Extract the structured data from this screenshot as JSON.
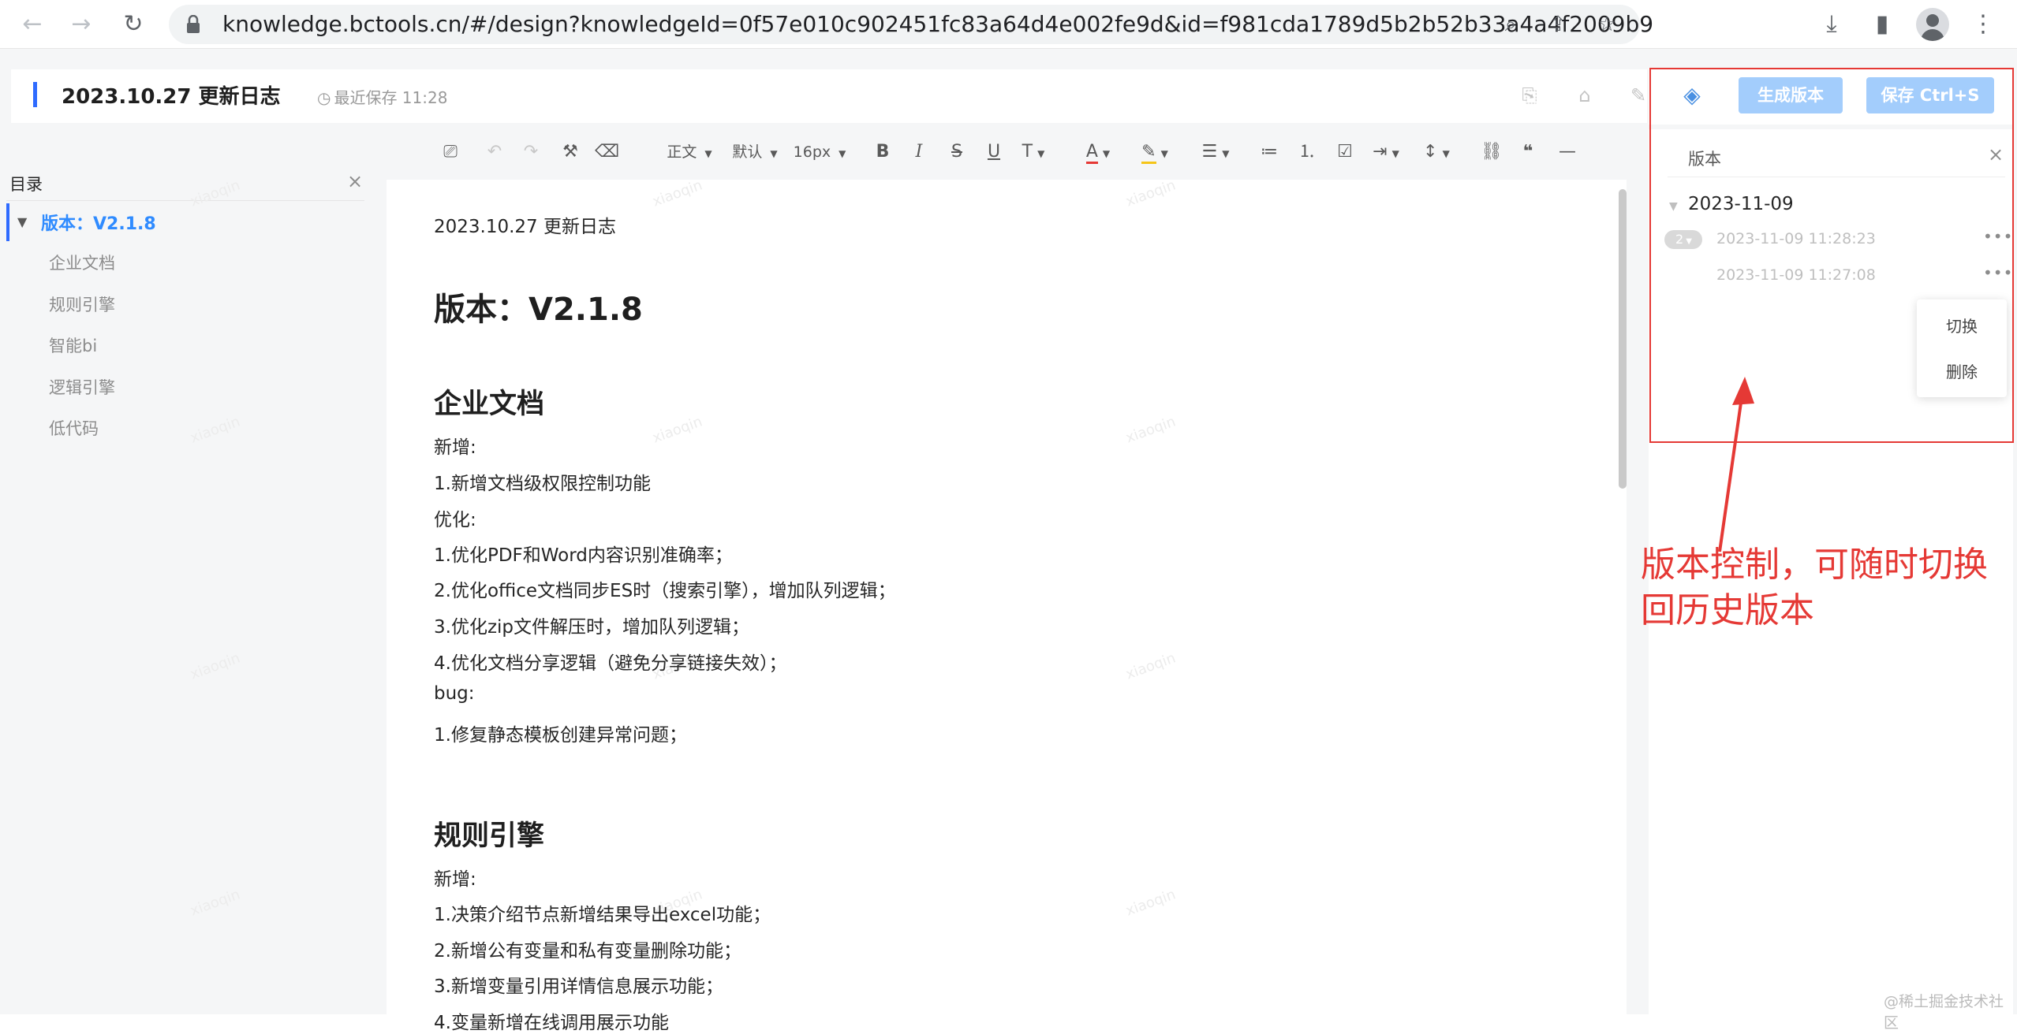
{
  "browser": {
    "url": "knowledge.bctools.cn/#/design?knowledgeId=0f57e010c902451fc83a64d4e002fe9d&id=f981cda1789d5b2b52b33a4a4f2009b9",
    "icons": [
      "back-icon",
      "forward-icon",
      "reload-icon",
      "lock-icon",
      "zoom-icon",
      "share-icon",
      "star-icon",
      "download-icon",
      "sidepanel-icon",
      "profile-icon",
      "menu-icon"
    ]
  },
  "header": {
    "title": "2023.10.27 更新日志",
    "save_status": "最近保存 11:28",
    "clock_glyph": "◷"
  },
  "outline": {
    "heading": "目录",
    "close": "×",
    "active_item": "版本：V2.1.8",
    "items": [
      "企业文档",
      "规则引擎",
      "智能bi",
      "逻辑引擎",
      "低代码"
    ]
  },
  "toolbar": {
    "paragraph": "正文",
    "font": "默认",
    "size": "16px",
    "bold": "B",
    "italic": "I",
    "strike": "S",
    "underline": "U",
    "superscript": "T",
    "font_color": "A"
  },
  "doc": {
    "title_line": "2023.10.27 更新日志",
    "h1": "版本：V2.1.8",
    "section1": {
      "heading": "企业文档",
      "lines": [
        "新增:",
        "1.新增文档级权限控制功能",
        "优化:",
        "1.优化PDF和Word内容识别准确率；",
        "2.优化office文档同步ES时（搜索引擎），增加队列逻辑；",
        "3.优化zip文件解压时，增加队列逻辑；",
        "4.优化文档分享逻辑（避免分享链接失效）；",
        "bug:",
        "1.修复静态模板创建异常问题；"
      ]
    },
    "section2": {
      "heading": "规则引擎",
      "lines": [
        "新增:",
        "1.决策介绍节点新增结果导出excel功能；",
        "2.新增公有变量和私有变量删除功能；",
        "3.新增变量引用详情信息展示功能；",
        "4.变量新增在线调用展示功能"
      ]
    },
    "watermark": "xiaoqin"
  },
  "right_panel": {
    "generate_version": "生成版本",
    "save": "保存 Ctrl+S",
    "title": "版本",
    "close": "×",
    "group_date": "2023-11-09",
    "badge": "2",
    "versions": [
      "2023-11-09 11:28:23",
      "2023-11-09 11:27:08"
    ],
    "more": "•••",
    "menu": [
      "切换",
      "删除"
    ]
  },
  "annotation": {
    "text": "版本控制，可随时切换回历史版本",
    "color": "#e53935"
  },
  "corner_watermark": "@稀土掘金技术社区",
  "colors": {
    "accent": "#2f6bff",
    "outline_active": "#2f8bff",
    "button_disabled": "#a3cdfc",
    "highlight": "#e53935"
  }
}
